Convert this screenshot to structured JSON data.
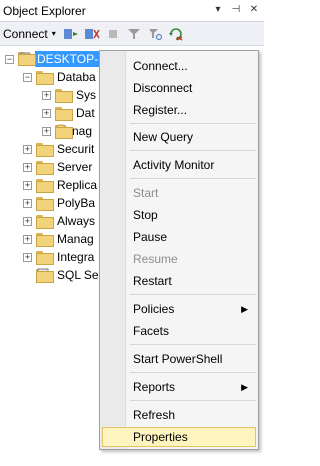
{
  "panel": {
    "title": "Object Explorer"
  },
  "header_icons": {
    "pin": "▾",
    "unpin": "⊣",
    "close": "✕"
  },
  "toolbar": {
    "connect_label": "Connect",
    "caret": "▾"
  },
  "tree": {
    "server": "DESKTOP-",
    "items": [
      {
        "label": "Databa"
      },
      {
        "label": "Sys"
      },
      {
        "label": "Dat"
      },
      {
        "label": "nag"
      },
      {
        "label": "Securit"
      },
      {
        "label": "Server"
      },
      {
        "label": "Replica"
      },
      {
        "label": "PolyBa"
      },
      {
        "label": "Always"
      },
      {
        "label": "Manag"
      },
      {
        "label": "Integra"
      },
      {
        "label": "SQL Se"
      }
    ],
    "expand_collapsed": "+",
    "expand_open": "−"
  },
  "context_menu": {
    "items": [
      {
        "label": "Connect..."
      },
      {
        "label": "Disconnect"
      },
      {
        "label": "Register..."
      },
      {
        "label": "New Query"
      },
      {
        "label": "Activity Monitor"
      },
      {
        "label": "Start"
      },
      {
        "label": "Stop"
      },
      {
        "label": "Pause"
      },
      {
        "label": "Resume"
      },
      {
        "label": "Restart"
      },
      {
        "label": "Policies"
      },
      {
        "label": "Facets"
      },
      {
        "label": "Start PowerShell"
      },
      {
        "label": "Reports"
      },
      {
        "label": "Refresh"
      },
      {
        "label": "Properties"
      }
    ],
    "submenu_arrow": "▶"
  }
}
